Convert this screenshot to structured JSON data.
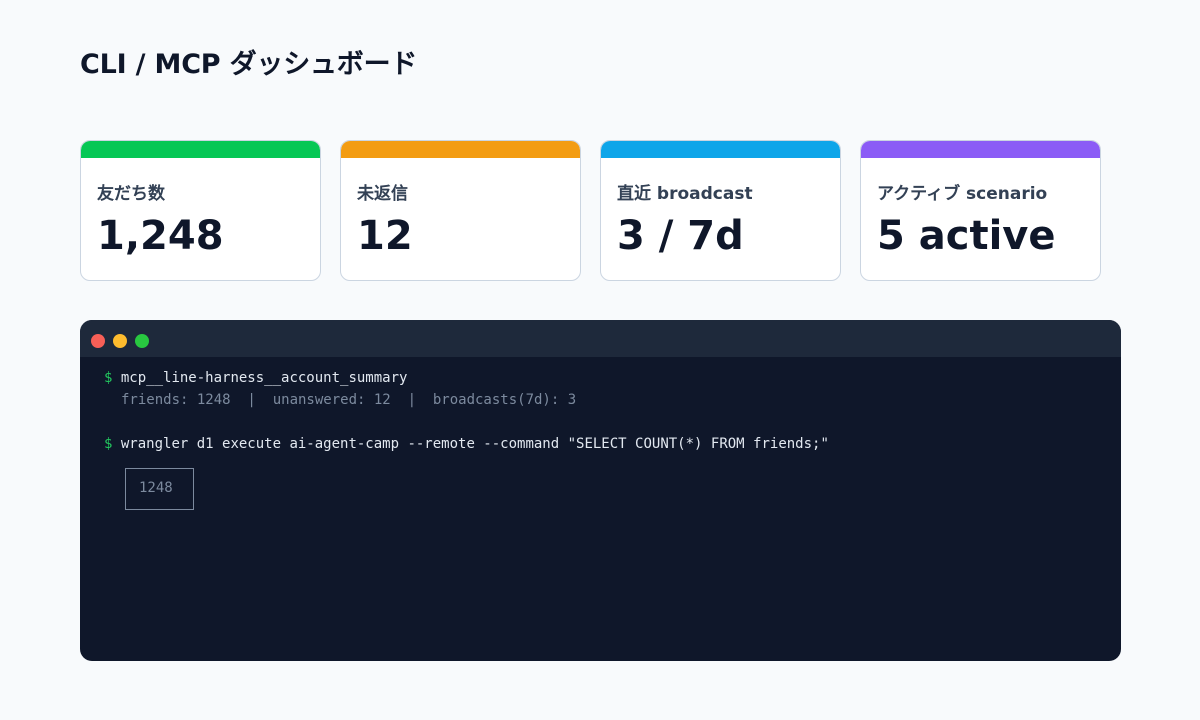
{
  "page": {
    "title": "CLI / MCP ダッシュボード"
  },
  "stats": [
    {
      "label": "友だち数",
      "value": "1,248",
      "accent": "#06c755"
    },
    {
      "label": "未返信",
      "value": "12",
      "accent": "#f39c12"
    },
    {
      "label": "直近 broadcast",
      "value": "3 / 7d",
      "accent": "#0ea5e9"
    },
    {
      "label": "アクティブ scenario",
      "value": "5 active",
      "accent": "#8b5cf6"
    }
  ],
  "terminal": {
    "prompt": "$",
    "commands": [
      {
        "command": "mcp__line-harness__account_summary",
        "output": "friends: 1248  |  unanswered: 12  |  broadcasts(7d): 3"
      },
      {
        "command": "wrangler d1 execute ai-agent-camp --remote --command \"SELECT COUNT(*) FROM friends;\"",
        "result": "1248"
      }
    ]
  },
  "colors": {
    "background": "#f8fafc",
    "terminal_bg": "#0f172a",
    "terminal_titlebar": "#1e293b",
    "prompt": "#22c55e",
    "command_text": "#e2e8f0",
    "output_text": "#7c8a9e",
    "window_close": "#f75f57",
    "window_minimize": "#febc2e",
    "window_maximize": "#28c840"
  }
}
